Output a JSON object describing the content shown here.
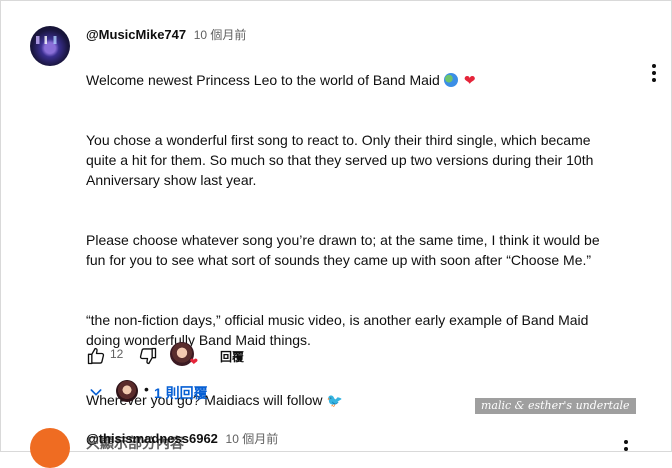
{
  "comment": {
    "author": "@MusicMike747",
    "time": "10 個月前",
    "paragraphs": [
      "Welcome newest Princess Leo to the world of Band Maid",
      "You chose a wonderful first song to react to. Only their third single, which became quite a hit for them. So much so that they served up two versions during their 10th Anniversary show last year.",
      "Please choose whatever song you’re drawn to; at the same time, I think it would be fun for you to see what sort of sounds they came up with soon after “Choose Me.”",
      "“the non-fiction days,” official music video, is another early example of Band Maid doing wonderfully Band Maid things.",
      "Wherever you go? Maidiacs will follow"
    ],
    "emoji_icons": [
      "globe-icon",
      "heart-icon",
      "bird-icon"
    ],
    "show_less": "只顯示部分內容",
    "like_count": "12",
    "reply_button": "回覆",
    "replies_label": "1 則回覆"
  },
  "next_comment": {
    "author": "@thisismadness6962",
    "time": "10 個月前"
  },
  "watermark": "malic & esther's undertale",
  "colors": {
    "link_blue": "#065fd4",
    "secondary_text": "#606060",
    "heart_red": "#e5253a",
    "next_avatar": "#ef6c22"
  }
}
